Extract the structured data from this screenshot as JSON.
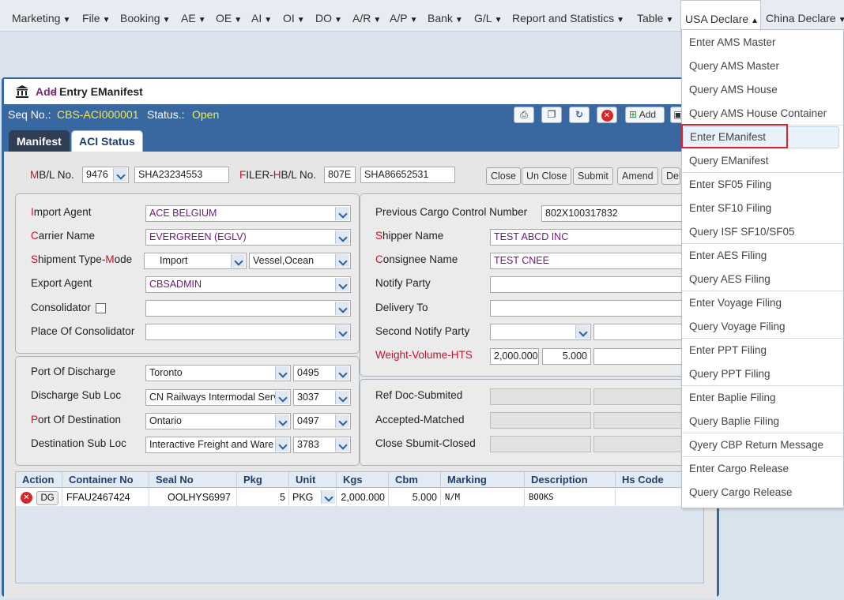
{
  "menubar": [
    {
      "label": "Marketing"
    },
    {
      "label": "File"
    },
    {
      "label": "Booking"
    },
    {
      "label": "AE"
    },
    {
      "label": "OE"
    },
    {
      "label": "AI"
    },
    {
      "label": "OI"
    },
    {
      "label": "DO"
    },
    {
      "label": "A/R"
    },
    {
      "label": "A/P"
    },
    {
      "label": "Bank"
    },
    {
      "label": "G/L"
    },
    {
      "label": "Report and Statistics"
    },
    {
      "label": "Table"
    },
    {
      "label": "USA Declare"
    },
    {
      "label": "China Declare"
    }
  ],
  "window": {
    "title_add": "Add",
    "title_sep": "-",
    "title_rest": "Entry EManifest",
    "seq_label": "Seq No.:",
    "seq_value": "CBS-ACI000001",
    "status_label": "Status.:",
    "status_value": "Open",
    "add_button": "Add"
  },
  "tabs": [
    {
      "label": "Manifest"
    },
    {
      "label": "ACI Status"
    }
  ],
  "header": {
    "mbl_label_first": "M",
    "mbl_label_mid": "B/L No.",
    "mbl_select": "9476",
    "mbl_value": "SHA23234553",
    "filer_first": "F",
    "filer_mid": "ILER-",
    "filer_h": "H",
    "filer_rest": "B/L No.",
    "filer_code": "807E",
    "filer_value": "SHA86652531",
    "buttons": [
      "Close",
      "Un Close",
      "Submit",
      "Amend",
      "Del"
    ]
  },
  "left": {
    "import_agent": {
      "first": "I",
      "rest": "mport Agent",
      "value": "ACE BELGIUM"
    },
    "carrier": {
      "first": "C",
      "rest": "arrier Name",
      "value": "EVERGREEN (EGLV)"
    },
    "shipment": {
      "first": "S",
      "mid": "hipment Type-",
      "m": "M",
      "rest": "ode",
      "type": "Import",
      "mode": "Vessel,Ocean"
    },
    "export_agent": {
      "label": "Export Agent",
      "value": "CBSADMIN"
    },
    "consolidator": {
      "label": "Consolidator",
      "value": ""
    },
    "place_consolidator": {
      "label": "Place Of Consolidator",
      "value": ""
    }
  },
  "ports": {
    "discharge": {
      "label": "Port Of Discharge",
      "value": "Toronto",
      "code": "0495"
    },
    "discharge_sub": {
      "label": "Discharge Sub Loc",
      "value": "CN Railways Intermodal  Serv",
      "code": "3037"
    },
    "destination": {
      "first": "P",
      "rest": "ort Of Destination",
      "value": "Ontario",
      "code": "0497"
    },
    "destination_sub": {
      "label": "Destination Sub Loc",
      "value": "Interactive Freight and  Ware",
      "code": "3783"
    }
  },
  "right": {
    "prev_ccn": {
      "label": "Previous Cargo Control Number",
      "value": "802X100317832"
    },
    "shipper": {
      "first": "S",
      "rest": "hipper Name",
      "value": "TEST ABCD INC"
    },
    "consignee": {
      "first": "C",
      "rest": "onsignee Name",
      "value": "TEST CNEE"
    },
    "notify": {
      "label": "Notify Party",
      "value": ""
    },
    "delivery": {
      "label": "Delivery To",
      "value": ""
    },
    "second_notify": {
      "label": "Second Notify Party",
      "value": ""
    },
    "wvh": {
      "w": "W",
      "eight": "eight-",
      "v": "V",
      "olume": "olume-HTS",
      "weight": "2,000.000",
      "volume": "5.000"
    },
    "ref_doc": {
      "label": "Ref Doc-Submited"
    },
    "accepted": {
      "label": "Accepted-Matched"
    },
    "closed": {
      "label": "Close Sbumit-Closed"
    }
  },
  "grid": {
    "headers": [
      "Action",
      "Container No",
      "Seal No",
      "Pkg",
      "Unit",
      "Kgs",
      "Cbm",
      "Marking",
      "Description",
      "Hs Code"
    ],
    "rows": [
      {
        "dg": "DG",
        "container": "FFAU2467424",
        "seal": "OOLHYS6997",
        "pkg": "5",
        "unit": "PKG",
        "kgs": "2,000.000",
        "cbm": "5.000",
        "marking": "N/M",
        "description": "BOOKS",
        "hs": ""
      }
    ]
  },
  "dropdown": [
    "Enter AMS Master",
    "Query AMS Master",
    "Query AMS House",
    "Query AMS House Container",
    "Enter EManifest",
    "Query EManifest",
    "Enter SF05 Filing",
    "Enter SF10 Filing",
    "Query ISF SF10/SF05",
    "Enter AES Filing",
    "Query AES Filing",
    "Enter Voyage Filing",
    "Query Voyage Filing",
    "Enter PPT Filing",
    "Query PPT Filing",
    "Enter Baplie Filing",
    "Query Baplie Filing",
    "Qyery CBP Return Message",
    "Enter Cargo Release",
    "Query Cargo Release"
  ],
  "colors": {
    "accent": "#39679f",
    "highlight": "#e0202a",
    "purple_value": "#6a1b7a",
    "required_red": "#c0142d"
  }
}
